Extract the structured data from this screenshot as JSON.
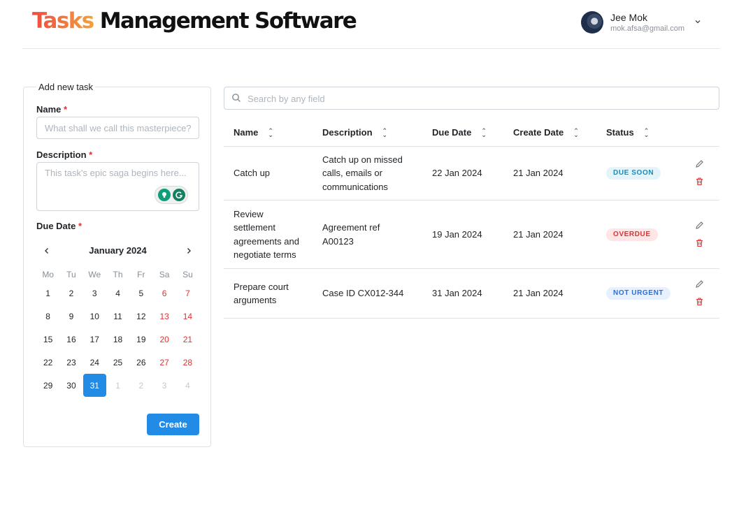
{
  "header": {
    "brand_first": "Tasks",
    "brand_rest": "Management Software",
    "user_name": "Jee Mok",
    "user_email": "mok.afsa@gmail.com"
  },
  "form": {
    "legend": "Add new task",
    "name_label": "Name",
    "name_placeholder": "What shall we call this masterpiece?",
    "description_label": "Description",
    "description_placeholder": "This task's epic saga begins here...",
    "due_date_label": "Due Date",
    "required_mark": "*",
    "create_label": "Create"
  },
  "calendar": {
    "title": "January 2024",
    "weekdays": [
      "Mo",
      "Tu",
      "We",
      "Th",
      "Fr",
      "Sa",
      "Su"
    ],
    "days": [
      {
        "d": "1"
      },
      {
        "d": "2"
      },
      {
        "d": "3"
      },
      {
        "d": "4"
      },
      {
        "d": "5"
      },
      {
        "d": "6",
        "weekend": true
      },
      {
        "d": "7",
        "weekend": true
      },
      {
        "d": "8"
      },
      {
        "d": "9"
      },
      {
        "d": "10"
      },
      {
        "d": "11"
      },
      {
        "d": "12"
      },
      {
        "d": "13",
        "weekend": true
      },
      {
        "d": "14",
        "weekend": true
      },
      {
        "d": "15"
      },
      {
        "d": "16"
      },
      {
        "d": "17"
      },
      {
        "d": "18"
      },
      {
        "d": "19"
      },
      {
        "d": "20",
        "weekend": true
      },
      {
        "d": "21",
        "weekend": true
      },
      {
        "d": "22"
      },
      {
        "d": "23"
      },
      {
        "d": "24"
      },
      {
        "d": "25"
      },
      {
        "d": "26"
      },
      {
        "d": "27",
        "weekend": true
      },
      {
        "d": "28",
        "weekend": true
      },
      {
        "d": "29"
      },
      {
        "d": "30"
      },
      {
        "d": "31",
        "selected": true
      },
      {
        "d": "1",
        "outside": true
      },
      {
        "d": "2",
        "outside": true
      },
      {
        "d": "3",
        "outside": true
      },
      {
        "d": "4",
        "outside": true
      }
    ]
  },
  "search": {
    "placeholder": "Search by any field"
  },
  "table": {
    "columns": [
      "Name",
      "Description",
      "Due Date",
      "Create Date",
      "Status"
    ],
    "rows": [
      {
        "name": [
          "Catch up"
        ],
        "description": [
          "Catch up on missed",
          "calls, emails or",
          "communications"
        ],
        "due_date": "22 Jan 2024",
        "create_date": "21 Jan 2024",
        "status": "DUE SOON",
        "status_color": "#1c8bb5"
      },
      {
        "name": [
          "Review",
          "settlement",
          "agreements and",
          "negotiate terms"
        ],
        "description": [
          "Agreement ref",
          "A00123"
        ],
        "due_date": "19 Jan 2024",
        "create_date": "21 Jan 2024",
        "status": "OVERDUE",
        "status_color": "#e03131"
      },
      {
        "name": [
          "Prepare court",
          "arguments"
        ],
        "description": [
          "Case ID CX012-344"
        ],
        "due_date": "31 Jan 2024",
        "create_date": "21 Jan 2024",
        "status": "NOT URGENT",
        "status_color": "#2f6fcf"
      }
    ]
  },
  "colors": {
    "accent": "#228be6",
    "required": "#e03131",
    "weekend": "#e03131"
  }
}
